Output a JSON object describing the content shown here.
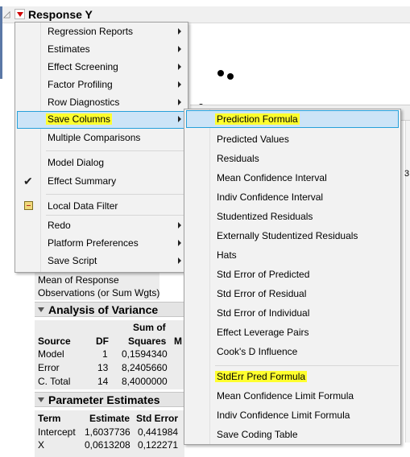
{
  "report": {
    "title": "Response Y",
    "summary_labels": [
      "Mean of Response",
      "Observations (or Sum Wgts)"
    ],
    "anova": {
      "title": "Analysis of Variance",
      "header_top": "Sum of",
      "columns": [
        "Source",
        "DF",
        "Squares",
        "M"
      ],
      "rows": [
        {
          "source": "Model",
          "df": "1",
          "ss": "0,1594340"
        },
        {
          "source": "Error",
          "df": "13",
          "ss": "8,2405660"
        },
        {
          "source": "C. Total",
          "df": "14",
          "ss": "8,4000000"
        }
      ]
    },
    "params": {
      "title": "Parameter Estimates",
      "columns": [
        "Term",
        "Estimate",
        "Std Error"
      ],
      "rows": [
        {
          "term": "Intercept",
          "estimate": "1,6037736",
          "stderr": "0,441984"
        },
        {
          "term": "X",
          "estimate": "0,0613208",
          "stderr": "0,122271"
        }
      ]
    },
    "edge_char": "3"
  },
  "menu": {
    "items": [
      {
        "label": "Regression Reports",
        "submenu": true
      },
      {
        "label": "Estimates",
        "submenu": true
      },
      {
        "label": "Effect Screening",
        "submenu": true
      },
      {
        "label": "Factor Profiling",
        "submenu": true
      },
      {
        "label": "Row Diagnostics",
        "submenu": true
      },
      {
        "label": "Save Columns",
        "submenu": true,
        "highlighted": true
      },
      {
        "label": "Multiple Comparisons",
        "submenu": false
      },
      {
        "label": "Model Dialog",
        "submenu": false
      },
      {
        "label": "Effect Summary",
        "submenu": false,
        "checked": true
      },
      {
        "label": "Local Data Filter",
        "submenu": false,
        "icon": "data-filter-icon"
      },
      {
        "label": "Redo",
        "submenu": true
      },
      {
        "label": "Platform Preferences",
        "submenu": true
      },
      {
        "label": "Save Script",
        "submenu": true
      }
    ]
  },
  "submenu": {
    "items": [
      {
        "label": "Prediction Formula",
        "highlighted": true
      },
      {
        "label": "Predicted Values"
      },
      {
        "label": "Residuals"
      },
      {
        "label": "Mean Confidence Interval"
      },
      {
        "label": "Indiv Confidence Interval"
      },
      {
        "label": "Studentized Residuals"
      },
      {
        "label": "Externally Studentized Residuals"
      },
      {
        "label": "Hats"
      },
      {
        "label": "Std Error of Predicted"
      },
      {
        "label": "Std Error of Residual"
      },
      {
        "label": "Std Error of Individual"
      },
      {
        "label": "Effect Leverage Pairs"
      },
      {
        "label": "Cook's D Influence"
      },
      {
        "label": "StdErr Pred Formula",
        "text_highlight": true
      },
      {
        "label": "Mean Confidence Limit Formula"
      },
      {
        "label": "Indiv Confidence Limit Formula"
      },
      {
        "label": "Save Coding Table"
      }
    ]
  },
  "colors": {
    "highlight_marker": "#ffff2e",
    "menu_selection": "#cce4f7",
    "menu_selection_border": "#26a0da",
    "red_triangle": "#d00000"
  }
}
